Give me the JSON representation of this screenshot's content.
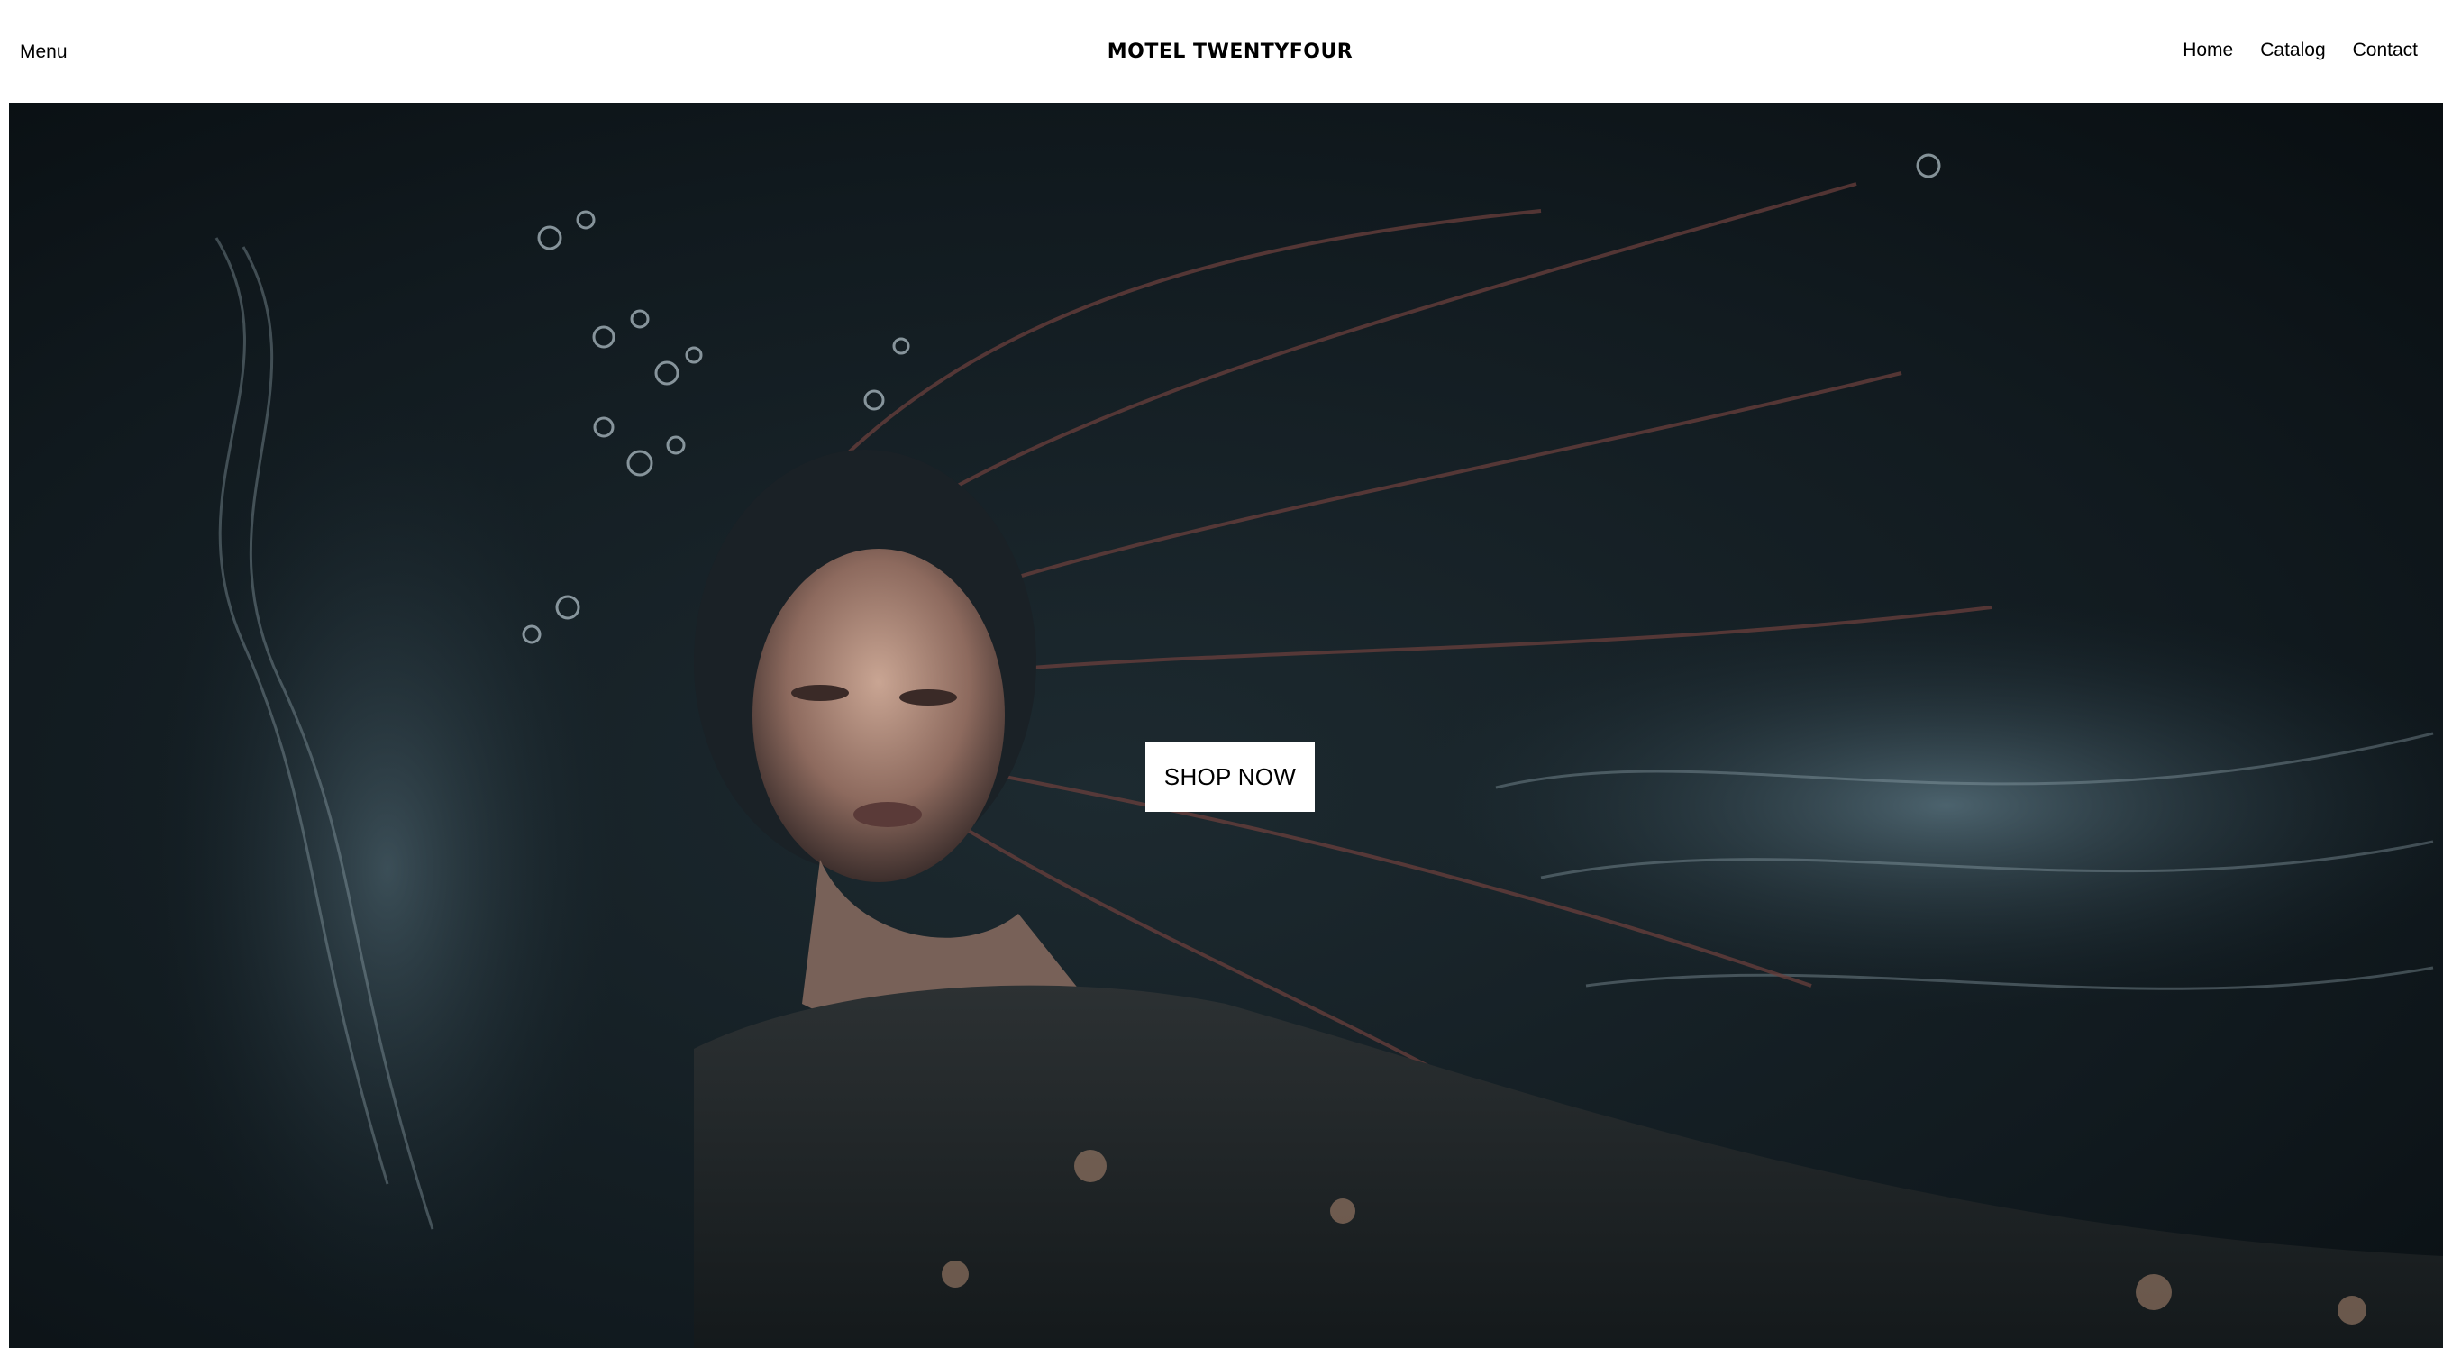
{
  "header": {
    "menu_label": "Menu",
    "brand": "MOTEL TWENTYFOUR",
    "nav": [
      "Home",
      "Catalog",
      "Contact"
    ]
  },
  "hero": {
    "image_alt": "Underwater portrait of a woman with flowing hair and a floral lace dress",
    "cta_label": "SHOP NOW"
  },
  "colors": {
    "header_bg": "#ffffff",
    "hero_bg": "#0d1317",
    "button_bg": "#ffffff",
    "text": "#000000"
  }
}
